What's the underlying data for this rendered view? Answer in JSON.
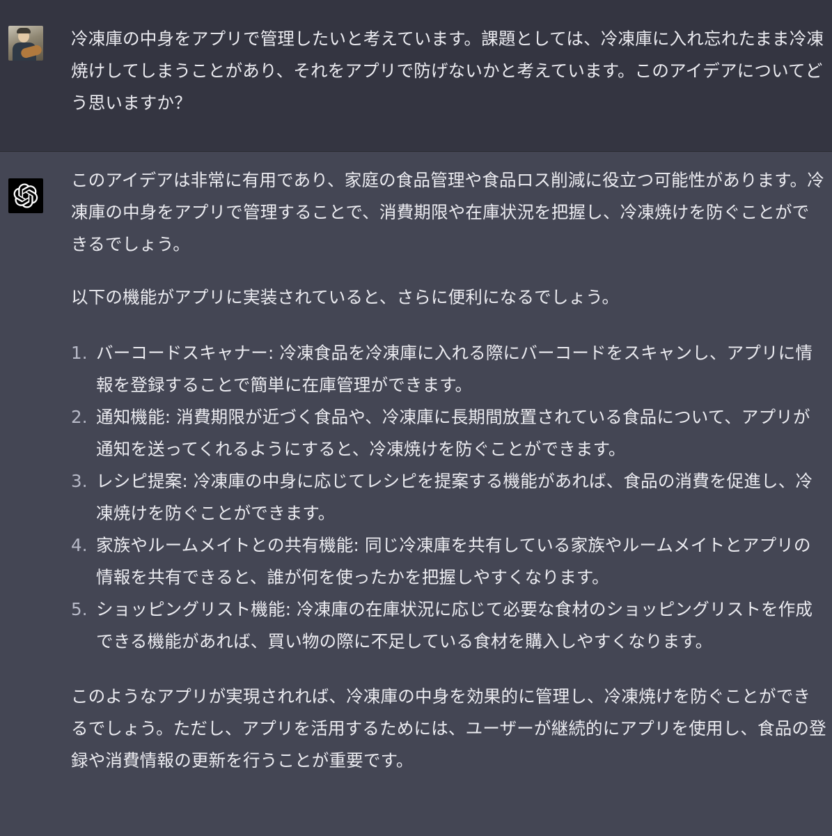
{
  "user_message": {
    "text": "冷凍庫の中身をアプリで管理したいと考えています。課題としては、冷凍庫に入れ忘れたまま冷凍焼けしてしまうことがあり、それをアプリで防げないかと考えています。このアイデアについてどう思いますか？"
  },
  "assistant_message": {
    "intro": "このアイデアは非常に有用であり、家庭の食品管理や食品ロス削減に役立つ可能性があります。冷凍庫の中身をアプリで管理することで、消費期限や在庫状況を把握し、冷凍焼けを防ぐことができるでしょう。",
    "lead": "以下の機能がアプリに実装されていると、さらに便利になるでしょう。",
    "features": [
      {
        "num": "1.",
        "text": "バーコードスキャナー: 冷凍食品を冷凍庫に入れる際にバーコードをスキャンし、アプリに情報を登録することで簡単に在庫管理ができます。"
      },
      {
        "num": "2.",
        "text": "通知機能: 消費期限が近づく食品や、冷凍庫に長期間放置されている食品について、アプリが通知を送ってくれるようにすると、冷凍焼けを防ぐことができます。"
      },
      {
        "num": "3.",
        "text": "レシピ提案: 冷凍庫の中身に応じてレシピを提案する機能があれば、食品の消費を促進し、冷凍焼けを防ぐことができます。"
      },
      {
        "num": "4.",
        "text": "家族やルームメイトとの共有機能: 同じ冷凍庫を共有している家族やルームメイトとアプリの情報を共有できると、誰が何を使ったかを把握しやすくなります。"
      },
      {
        "num": "5.",
        "text": "ショッピングリスト機能: 冷凍庫の在庫状況に応じて必要な食材のショッピングリストを作成できる機能があれば、買い物の際に不足している食材を購入しやすくなります。"
      }
    ],
    "conclusion": "このようなアプリが実現されれば、冷凍庫の中身を効果的に管理し、冷凍焼けを防ぐことができるでしょう。ただし、アプリを活用するためには、ユーザーが継続的にアプリを使用し、食品の登録や消費情報の更新を行うことが重要です。"
  },
  "icons": {
    "user_avatar": "user-avatar-photo",
    "assistant_avatar": "openai-logo-icon"
  },
  "colors": {
    "user_bg": "#343541",
    "assistant_bg": "#444654",
    "text": "#ececf1",
    "logo_bg": "#000000"
  }
}
